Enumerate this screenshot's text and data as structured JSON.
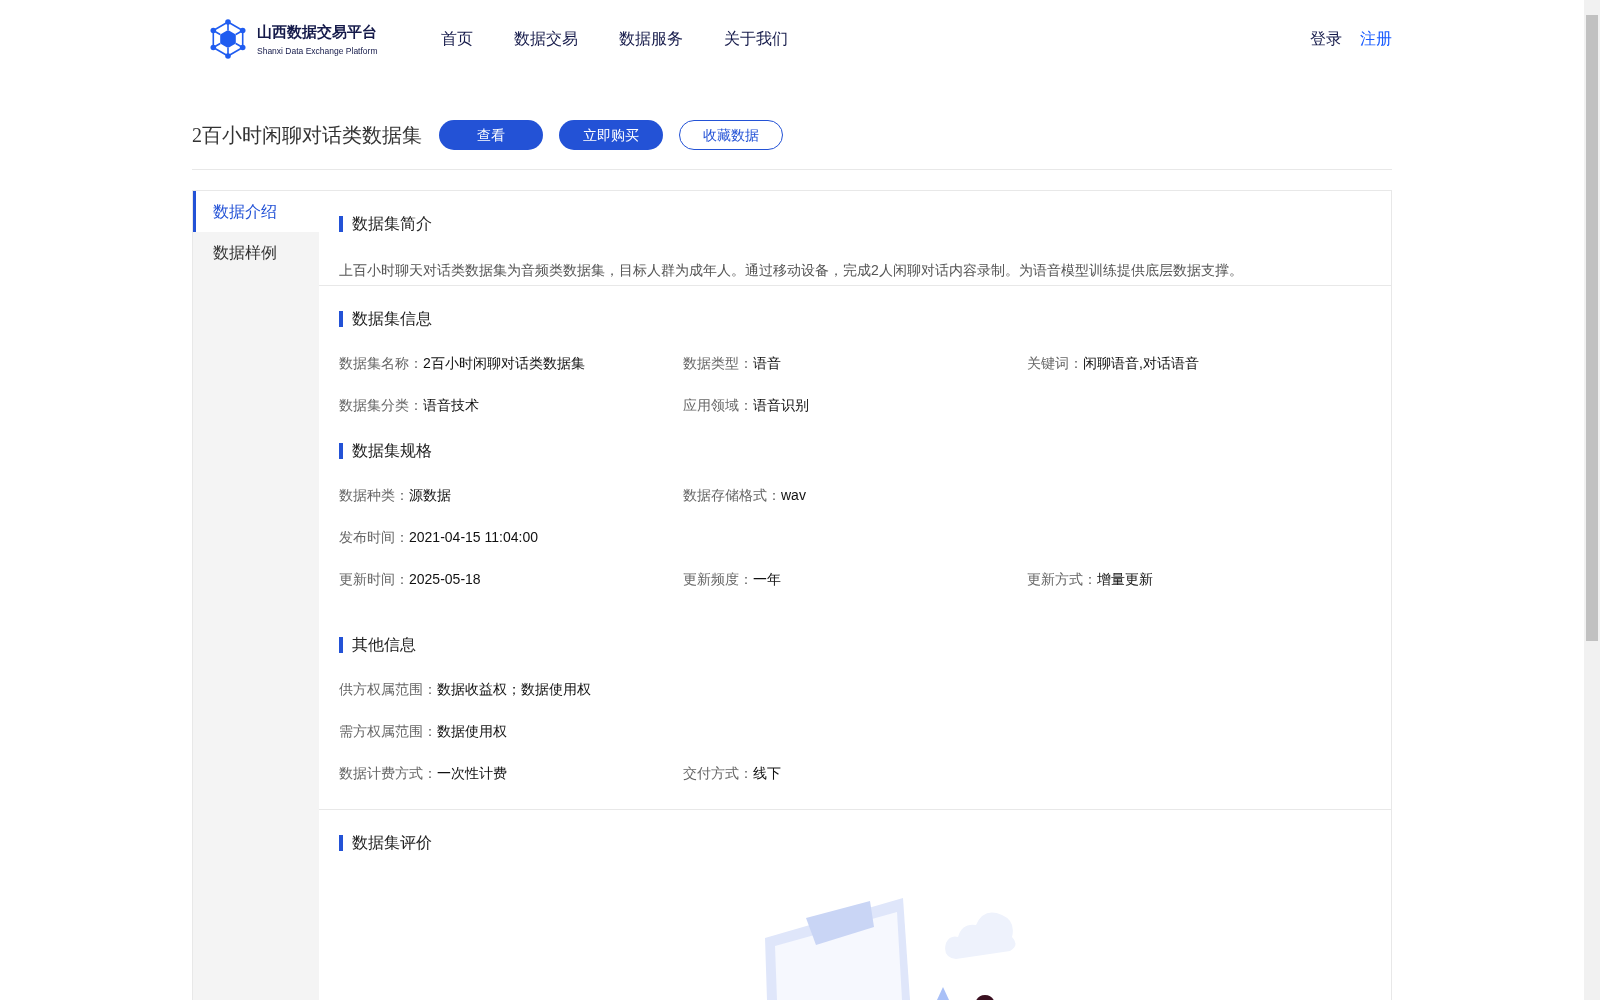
{
  "header": {
    "logo": {
      "title": "山西数据交易平台",
      "subtitle": "Shanxi Data Exchange Platform"
    },
    "nav": [
      {
        "label": "首页"
      },
      {
        "label": "数据交易"
      },
      {
        "label": "数据服务"
      },
      {
        "label": "关于我们"
      }
    ],
    "account_links": [
      {
        "label": "登录",
        "kind": "login"
      },
      {
        "label": "注册",
        "kind": "register"
      }
    ]
  },
  "dataset": {
    "title": "2百小时闲聊对话类数据集",
    "actions": [
      {
        "label": "查看",
        "kind": "view"
      },
      {
        "label": "立即购买",
        "kind": "buy"
      },
      {
        "label": "收藏数据",
        "kind": "favorite"
      }
    ]
  },
  "sidebar": {
    "items": [
      {
        "label": "数据介绍",
        "selected": true
      },
      {
        "label": "数据样例",
        "selected": false
      }
    ]
  },
  "panels": [
    {
      "sections": [
        {
          "heading": "数据集简介",
          "kind": "text",
          "text": "上百小时聊天对话类数据集为音频类数据集，目标人群为成年人。通过移动设备，完成2人闲聊对话内容录制。为语音模型训练提供底层数据支撑。"
        }
      ]
    },
    {
      "sections": [
        {
          "heading": "数据集信息",
          "kind": "fields",
          "rows": [
            [
              {
                "label": "数据集名称：",
                "value": "2百小时闲聊对话类数据集"
              },
              {
                "label": "数据类型：",
                "value": "语音"
              },
              {
                "label": "关键词：",
                "value": "闲聊语音,对话语音"
              }
            ],
            [
              {
                "label": "数据集分类：",
                "value": "语音技术"
              },
              {
                "label": "应用领域：",
                "value": "语音识别"
              }
            ]
          ]
        },
        {
          "heading": "数据集规格",
          "kind": "fields",
          "rows": [
            [
              {
                "label": "数据种类：",
                "value": "源数据"
              },
              {
                "label": "数据存储格式：",
                "value": "wav"
              }
            ],
            [
              {
                "label": "发布时间：",
                "value": "2021-04-15 11:04:00"
              }
            ],
            [
              {
                "label": "更新时间：",
                "value": "2025-05-18"
              },
              {
                "label": "更新频度：",
                "value": "一年"
              },
              {
                "label": "更新方式：",
                "value": "增量更新"
              }
            ]
          ]
        },
        {
          "heading": "其他信息",
          "kind": "fields",
          "rows": [
            [
              {
                "label": "供方权属范围：",
                "value": "数据收益权；数据使用权"
              }
            ],
            [
              {
                "label": "需方权属范围：",
                "value": "数据使用权"
              }
            ],
            [
              {
                "label": "数据计费方式：",
                "value": "一次性计费"
              },
              {
                "label": "交付方式：",
                "value": "线下"
              }
            ]
          ]
        }
      ]
    },
    {
      "sections": [
        {
          "heading": "数据集评价",
          "kind": "empty"
        }
      ]
    }
  ]
}
